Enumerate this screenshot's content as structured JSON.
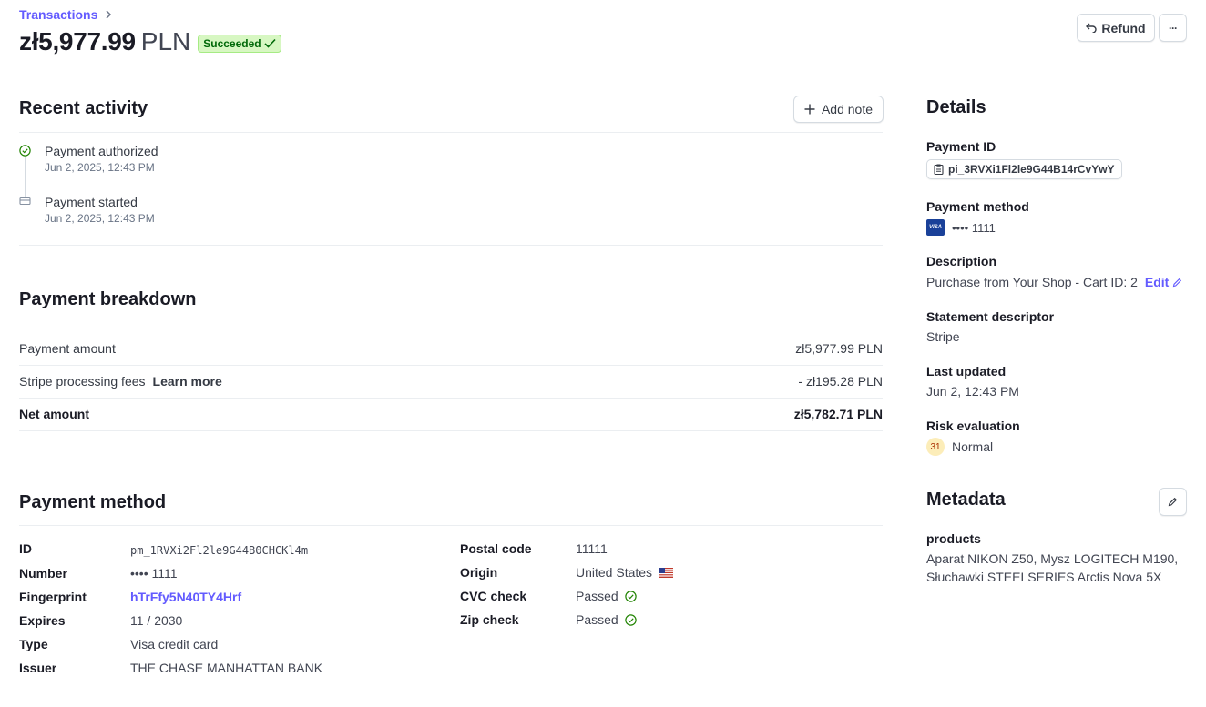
{
  "header": {
    "breadcrumb": "Transactions",
    "amount": "zł5,977.99",
    "currency": "PLN",
    "status": "Succeeded",
    "refund_label": "Refund",
    "more_label": "···"
  },
  "activity": {
    "title": "Recent activity",
    "add_note_label": "Add note",
    "items": [
      {
        "title": "Payment authorized",
        "time": "Jun 2, 2025, 12:43 PM",
        "icon": "check-circle-icon"
      },
      {
        "title": "Payment started",
        "time": "Jun 2, 2025, 12:43 PM",
        "icon": "card-icon"
      }
    ]
  },
  "breakdown": {
    "title": "Payment breakdown",
    "rows": [
      {
        "label": "Payment amount",
        "value": "zł5,977.99 PLN"
      },
      {
        "label": "Stripe processing fees",
        "link": "Learn more",
        "value": "- zł195.28 PLN"
      },
      {
        "label": "Net amount",
        "value": "zł5,782.71 PLN"
      }
    ]
  },
  "payment_method": {
    "title": "Payment method",
    "left": [
      {
        "label": "ID",
        "value": "pm_1RVXi2Fl2le9G44B0CHCKl4m"
      },
      {
        "label": "Number",
        "value": "•••• 1111"
      },
      {
        "label": "Fingerprint",
        "value": "hTrFfy5N40TY4Hrf"
      },
      {
        "label": "Expires",
        "value": "11 / 2030"
      },
      {
        "label": "Type",
        "value": "Visa credit card"
      },
      {
        "label": "Issuer",
        "value": "THE CHASE MANHATTAN BANK"
      }
    ],
    "right": [
      {
        "label": "Postal code",
        "value": "11111"
      },
      {
        "label": "Origin",
        "value": "United States"
      },
      {
        "label": "CVC check",
        "value": "Passed"
      },
      {
        "label": "Zip check",
        "value": "Passed"
      }
    ]
  },
  "details": {
    "title": "Details",
    "payment_id_label": "Payment ID",
    "payment_id": "pi_3RVXi1Fl2le9G44B14rCvYwY",
    "payment_method_label": "Payment method",
    "card_brand": "VISA",
    "card_number": "•••• 1111",
    "description_label": "Description",
    "description": "Purchase from Your Shop - Cart ID: 2",
    "edit_label": "Edit",
    "statement_label": "Statement descriptor",
    "statement": "Stripe",
    "updated_label": "Last updated",
    "updated": "Jun 2, 12:43 PM",
    "risk_label": "Risk evaluation",
    "risk_score": "31",
    "risk_level": "Normal"
  },
  "metadata": {
    "title": "Metadata",
    "key": "products",
    "value_line1": "Aparat NIKON Z50, Mysz LOGITECH M190,",
    "value_line2": "Słuchawki STEELSERIES Arctis Nova 5X"
  },
  "colors": {
    "accent": "#635bff",
    "success_bg": "#d7f7c2",
    "success_text": "#006908",
    "risk_bg": "#fcedb9"
  }
}
